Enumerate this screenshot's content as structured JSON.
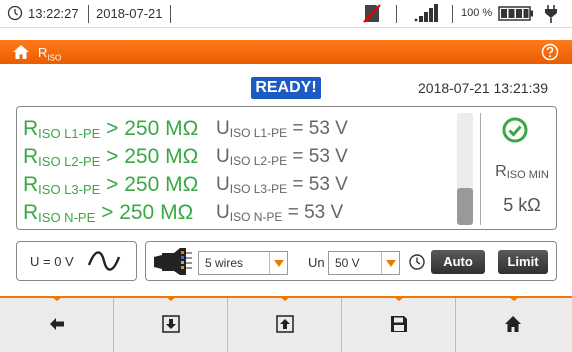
{
  "status": {
    "time": "13:22:27",
    "date": "2018-07-21",
    "battery_percent": "100 %",
    "signal_bars": 4,
    "icons": [
      "clock-icon",
      "no-sd-card-icon",
      "signal-icon",
      "battery-icon",
      "plug-icon"
    ]
  },
  "titlebar": {
    "title_main": "R",
    "title_sub": "ISO",
    "accent": "#f07800"
  },
  "ready": "READY!",
  "datetime": "2018-07-21 13:21:39",
  "results": [
    {
      "r_sym": "R",
      "r_sub": "ISO L1-PE",
      "r_val": "> 250 MΩ",
      "u_sym": "U",
      "u_sub": "ISO L1-PE",
      "u_val": "= 53 V"
    },
    {
      "r_sym": "R",
      "r_sub": "ISO L2-PE",
      "r_val": "> 250 MΩ",
      "u_sym": "U",
      "u_sub": "ISO L2-PE",
      "u_val": "= 53 V"
    },
    {
      "r_sym": "R",
      "r_sub": "ISO L3-PE",
      "r_val": "> 250 MΩ",
      "u_sym": "U",
      "u_sub": "ISO L3-PE",
      "u_val": "= 53 V"
    },
    {
      "r_sym": "R",
      "r_sub": "ISO N-PE",
      "r_val": "> 250 MΩ",
      "u_sym": "U",
      "u_sub": "ISO N-PE",
      "u_val": "= 53 V"
    }
  ],
  "gauge_level": 0.33,
  "rmin": {
    "sym": "R",
    "sub": "ISO MIN",
    "value": "5 kΩ"
  },
  "voltage": "U = 0 V",
  "wires": "5 wires",
  "un_label": "Un",
  "un_value": "50 V",
  "auto_label": "Auto",
  "limit_label": "Limit",
  "nav": [
    "back-icon",
    "download-icon",
    "upload-icon",
    "save-icon",
    "home-icon"
  ]
}
